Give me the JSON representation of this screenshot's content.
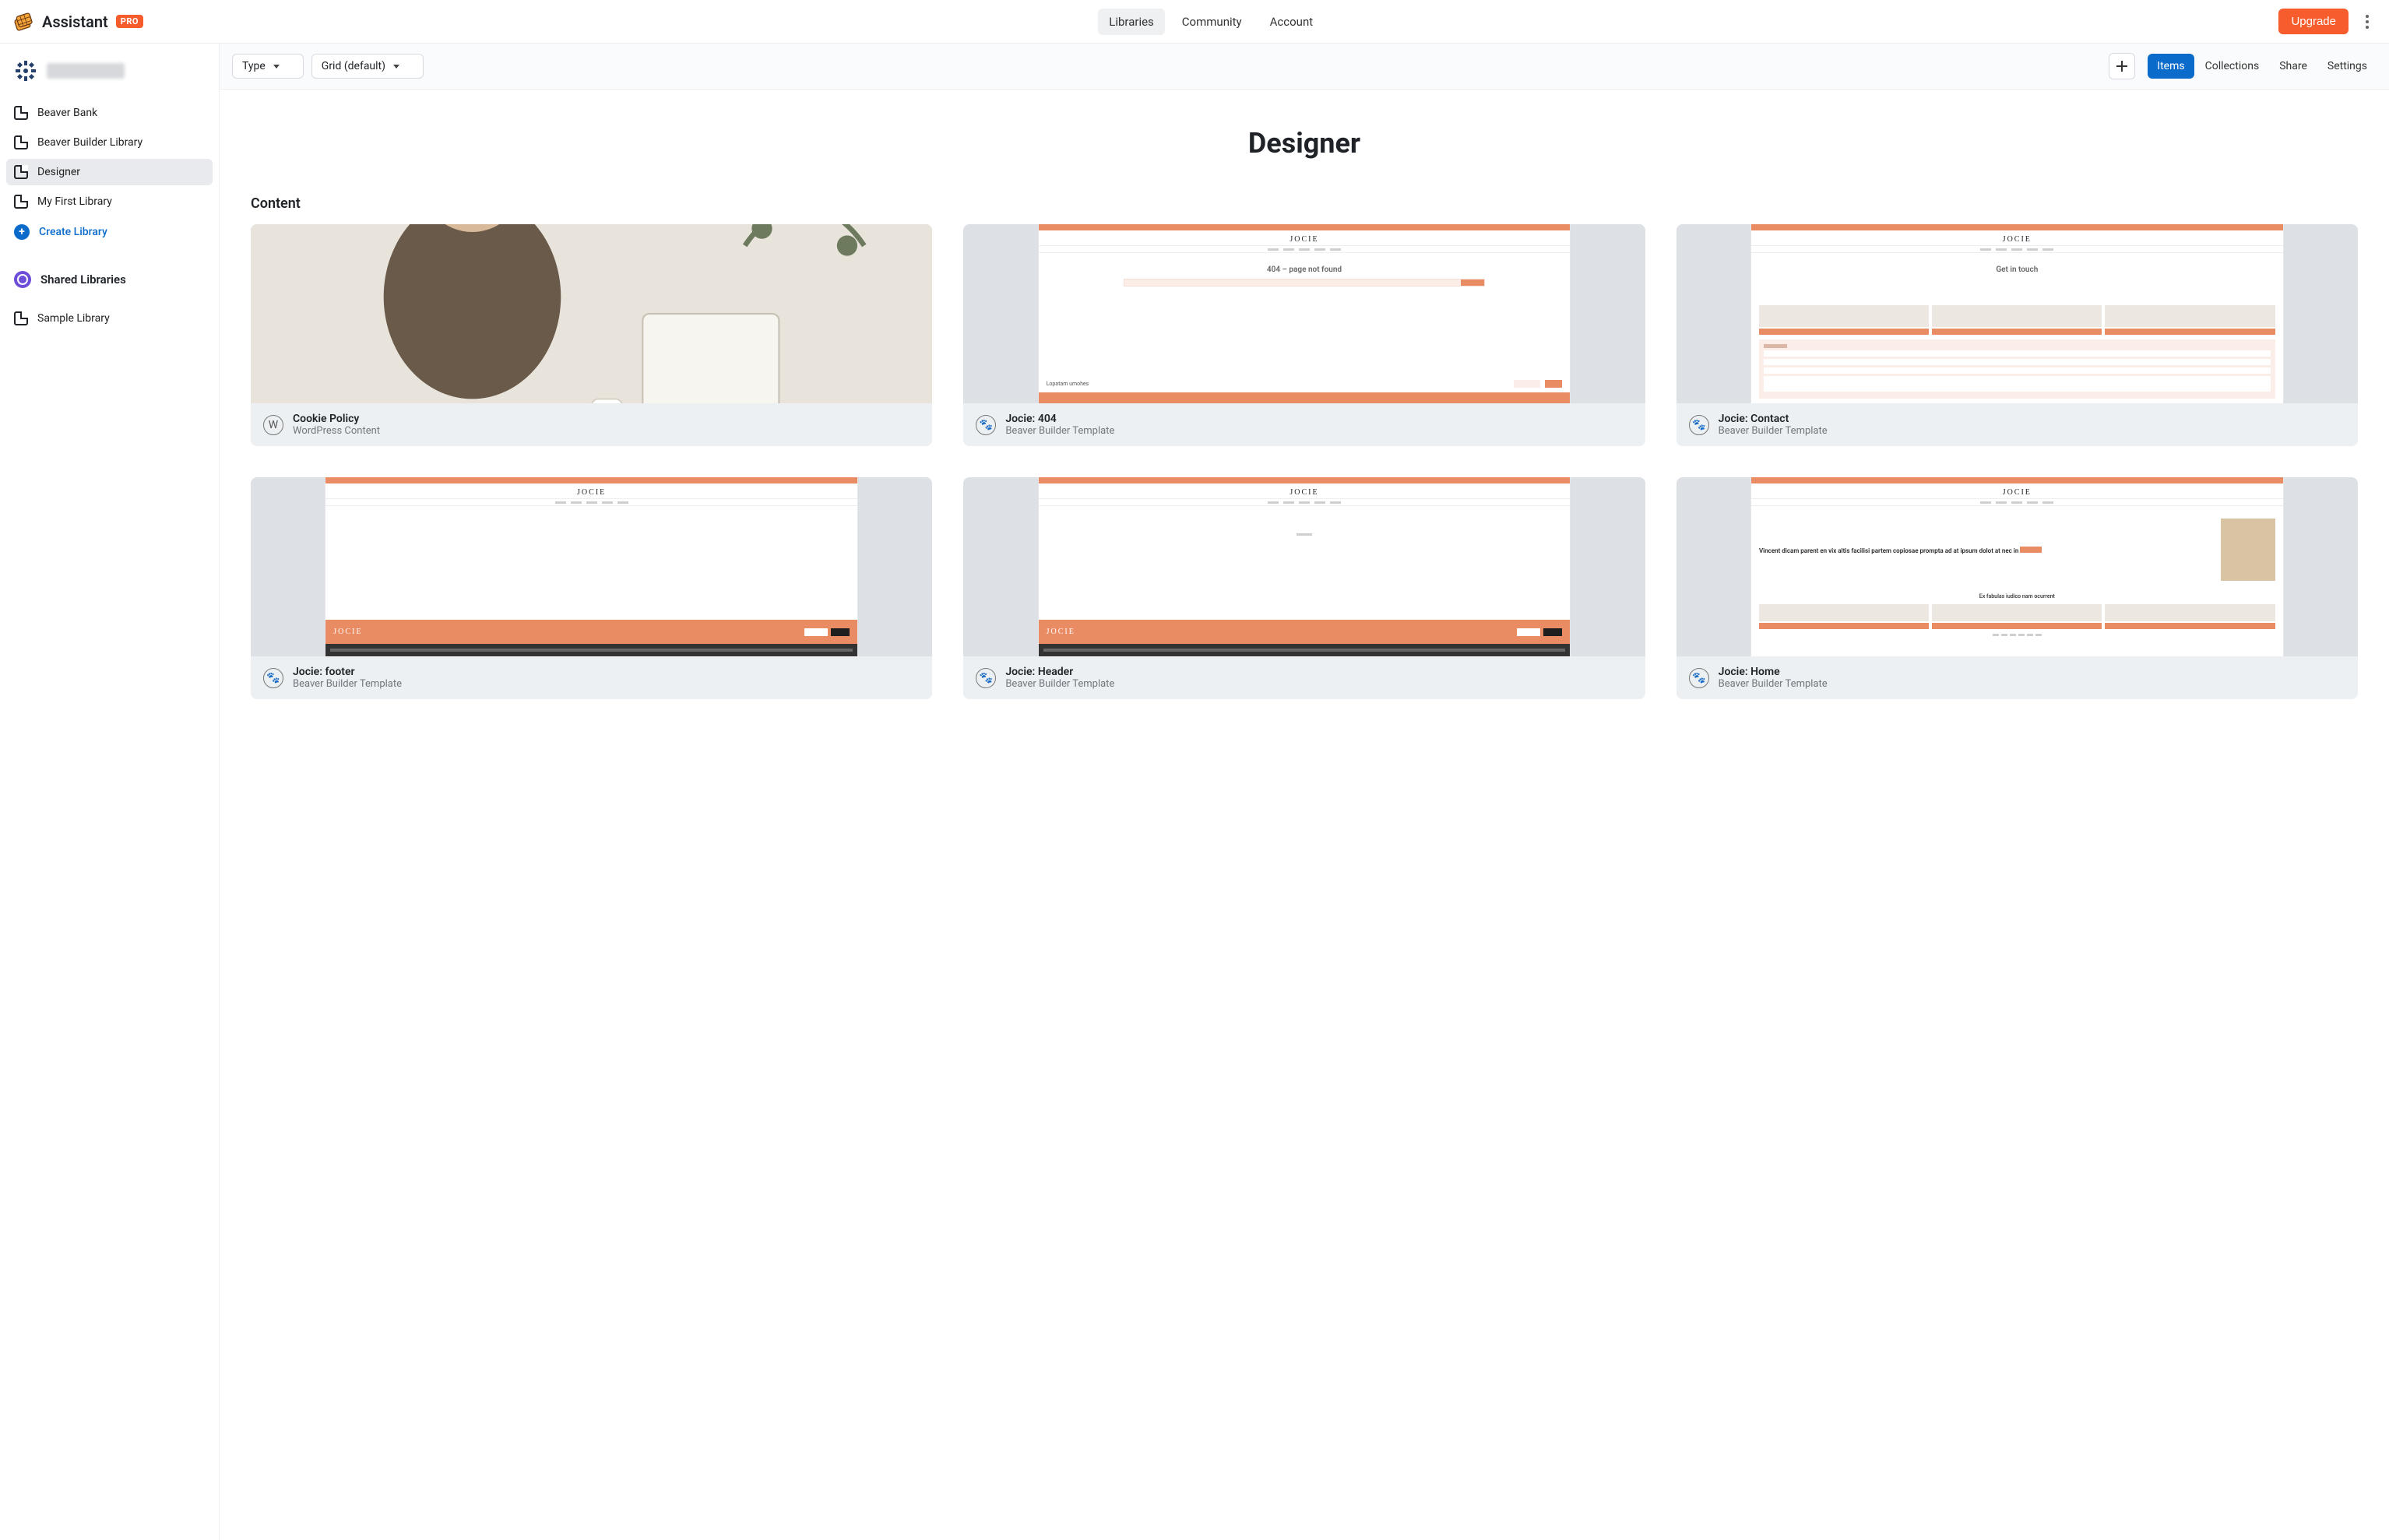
{
  "brand": {
    "name": "Assistant",
    "badge": "PRO"
  },
  "nav": {
    "libraries": "Libraries",
    "community": "Community",
    "account": "Account",
    "upgrade": "Upgrade"
  },
  "toolbar": {
    "type_label": "Type",
    "view_label": "Grid (default)",
    "tabs": {
      "items": "Items",
      "collections": "Collections",
      "share": "Share",
      "settings": "Settings"
    }
  },
  "sidebar": {
    "team_name": "(redacted)",
    "libs": [
      "Beaver Bank",
      "Beaver Builder Library",
      "Designer",
      "My First Library"
    ],
    "create": "Create Library",
    "shared_heading": "Shared Libraries",
    "shared_items": [
      "Sample Library"
    ]
  },
  "page": {
    "title": "Designer",
    "section": "Content"
  },
  "cards": [
    {
      "title": "Cookie Policy",
      "sub": "WordPress Content",
      "icon": "wp"
    },
    {
      "title": "Jocie: 404",
      "sub": "Beaver Builder Template",
      "icon": "bb"
    },
    {
      "title": "Jocie: Contact",
      "sub": "Beaver Builder Template",
      "icon": "bb"
    },
    {
      "title": "Jocie: footer",
      "sub": "Beaver Builder Template",
      "icon": "bb"
    },
    {
      "title": "Jocie: Header",
      "sub": "Beaver Builder Template",
      "icon": "bb"
    },
    {
      "title": "Jocie: Home",
      "sub": "Beaver Builder Template",
      "icon": "bb"
    }
  ]
}
